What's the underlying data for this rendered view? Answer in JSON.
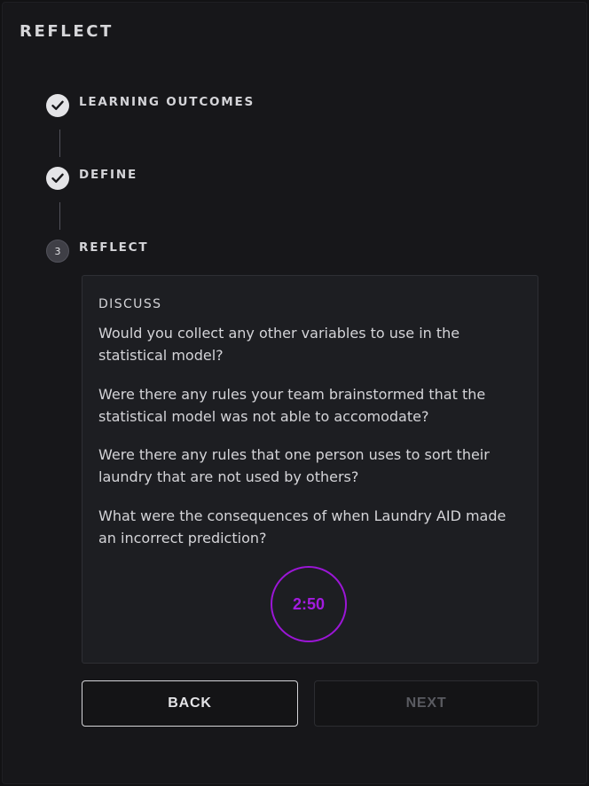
{
  "header": {
    "title": "REFLECT"
  },
  "steps": [
    {
      "label": "LEARNING OUTCOMES",
      "status": "complete",
      "icon": "check-icon"
    },
    {
      "label": "DEFINE",
      "status": "complete",
      "icon": "check-icon"
    },
    {
      "label": "REFLECT",
      "status": "current",
      "number": "3"
    }
  ],
  "discuss": {
    "heading": "DISCUSS",
    "questions": [
      "Would you collect any other variables to use in the statistical model?",
      "Were there any rules your team brainstormed that the statistical model was not able to accomodate?",
      "Were there any rules that one person uses to sort their laundry that are not used by others?",
      "What were the consequences of when Laundry AID made an incorrect prediction?"
    ],
    "timer": "2:50"
  },
  "buttons": {
    "back": "BACK",
    "next": "NEXT"
  },
  "colors": {
    "background": "#17171a",
    "accent": "#a31bdf",
    "card": "#1d1e22",
    "disabled_text": "#5a5b61"
  }
}
